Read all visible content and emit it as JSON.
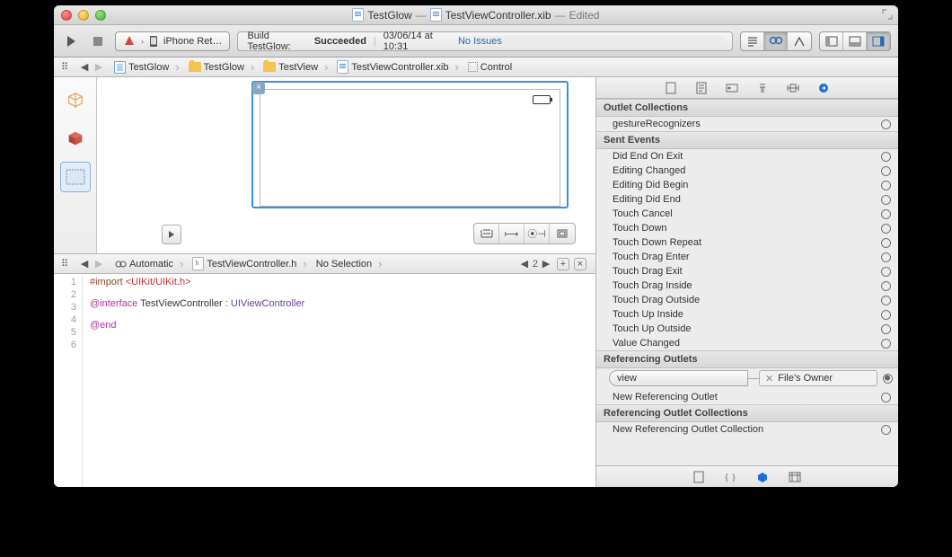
{
  "title": {
    "project": "TestGlow",
    "file": "TestViewController.xib",
    "status": "Edited"
  },
  "toolbar": {
    "scheme_target": "iPhone Ret…",
    "activity_prefix": "Build TestGlow:",
    "activity_result": "Succeeded",
    "activity_time": "03/06/14 at 10:31",
    "activity_issues": "No Issues"
  },
  "breadcrumb": {
    "items": [
      {
        "icon": "proj",
        "label": "TestGlow"
      },
      {
        "icon": "folder",
        "label": "TestGlow"
      },
      {
        "icon": "folder",
        "label": "TestView"
      },
      {
        "icon": "doc",
        "label": "TestViewController.xib"
      },
      {
        "icon": "square",
        "label": "Control"
      }
    ]
  },
  "assistant_bar": {
    "mode": "Automatic",
    "file": "TestViewController.h",
    "selection": "No Selection",
    "counter": "2"
  },
  "code": {
    "lines": [
      "1",
      "2",
      "3",
      "4",
      "5",
      "6"
    ],
    "l1a": "#import ",
    "l1b": "<UIKit/UIKit.h>",
    "l3a": "@interface",
    "l3b": " TestViewController : ",
    "l3c": "UIViewController",
    "l5": "@end"
  },
  "inspector": {
    "outlet_collections_title": "Outlet Collections",
    "outlet_collections": [
      "gestureRecognizers"
    ],
    "sent_events_title": "Sent Events",
    "sent_events": [
      "Did End On Exit",
      "Editing Changed",
      "Editing Did Begin",
      "Editing Did End",
      "Touch Cancel",
      "Touch Down",
      "Touch Down Repeat",
      "Touch Drag Enter",
      "Touch Drag Exit",
      "Touch Drag Inside",
      "Touch Drag Outside",
      "Touch Up Inside",
      "Touch Up Outside",
      "Value Changed"
    ],
    "referencing_outlets_title": "Referencing Outlets",
    "ref_outlet_name": "view",
    "ref_outlet_dest": "File's Owner",
    "new_ref_outlet": "New Referencing Outlet",
    "referencing_collections_title": "Referencing Outlet Collections",
    "new_ref_collection": "New Referencing Outlet Collection"
  }
}
